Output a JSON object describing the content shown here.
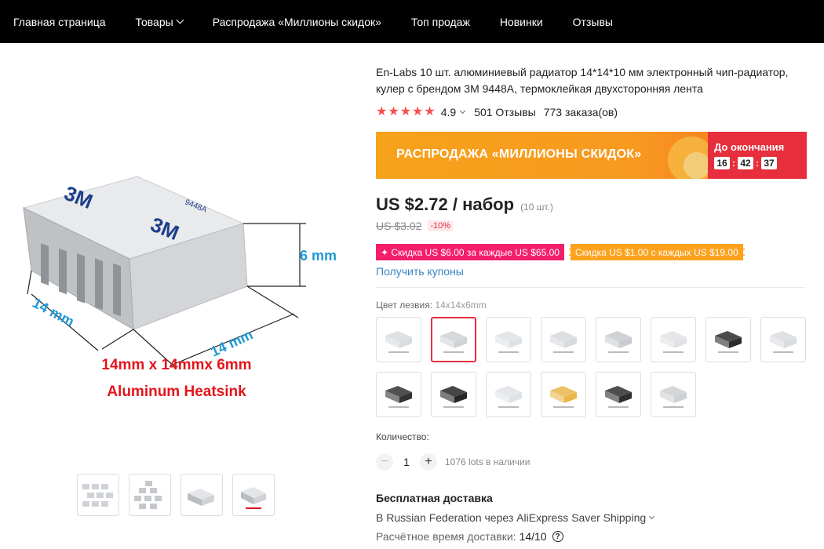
{
  "nav": {
    "items": [
      {
        "label": "Главная страница"
      },
      {
        "label": "Товары"
      },
      {
        "label": "Распродажа «Миллионы скидок»"
      },
      {
        "label": "Топ продаж"
      },
      {
        "label": "Новинки"
      },
      {
        "label": "Отзывы"
      }
    ]
  },
  "gallery": {
    "image_caption_line1": "14mm x 14mmx 6mm",
    "image_caption_line2": "Aluminum Heatsink",
    "dim_height": "6 mm",
    "dim_left": "14 mm",
    "dim_right": "14 mm",
    "brand_print": "3M",
    "tape_print": "9448A"
  },
  "product": {
    "title": "En-Labs 10 шт. алюминиевый радиатор 14*14*10 мм электронный чип-радиатор, кулер с брендом 3M 9448A, термоклейкая двухсторонняя лента",
    "rating": "4.9",
    "reviews": "501 Отзывы",
    "orders": "773 заказа(ов)",
    "stars": 5
  },
  "sale": {
    "text": "РАСПРОДАЖА «МИЛЛИОНЫ СКИДОК»",
    "until": "До окончания",
    "hours": "16",
    "minutes": "42",
    "seconds": "37"
  },
  "price": {
    "main": "US $2.72 / набор",
    "unit": "(10 шт.)",
    "old": "US $3.02",
    "discount": "-10%"
  },
  "coupons": {
    "pink": "✦ Скидка US $6.00 за каждые US $65.00",
    "orange": "Скидка US $1.00 с каждых US $19.00",
    "get": "Получить купоны"
  },
  "variant": {
    "label": "Цвет лезвия:",
    "selected": "14x14x6mm",
    "count": 14,
    "selected_index": 1
  },
  "quantity": {
    "label": "Количество:",
    "value": "1",
    "stock": "1076 lots в наличии"
  },
  "shipping": {
    "title": "Бесплатная доставка",
    "line": "В Russian Federation через AliExpress Saver Shipping",
    "eta_label": "Расчётное время доставки:",
    "eta_value": "14/10"
  },
  "colors": {
    "accent": "#e62e3c",
    "star": "#f84d4d",
    "link": "#3a86c8",
    "dim_blue": "#1f9ad6",
    "caption_red": "#e3151b"
  }
}
